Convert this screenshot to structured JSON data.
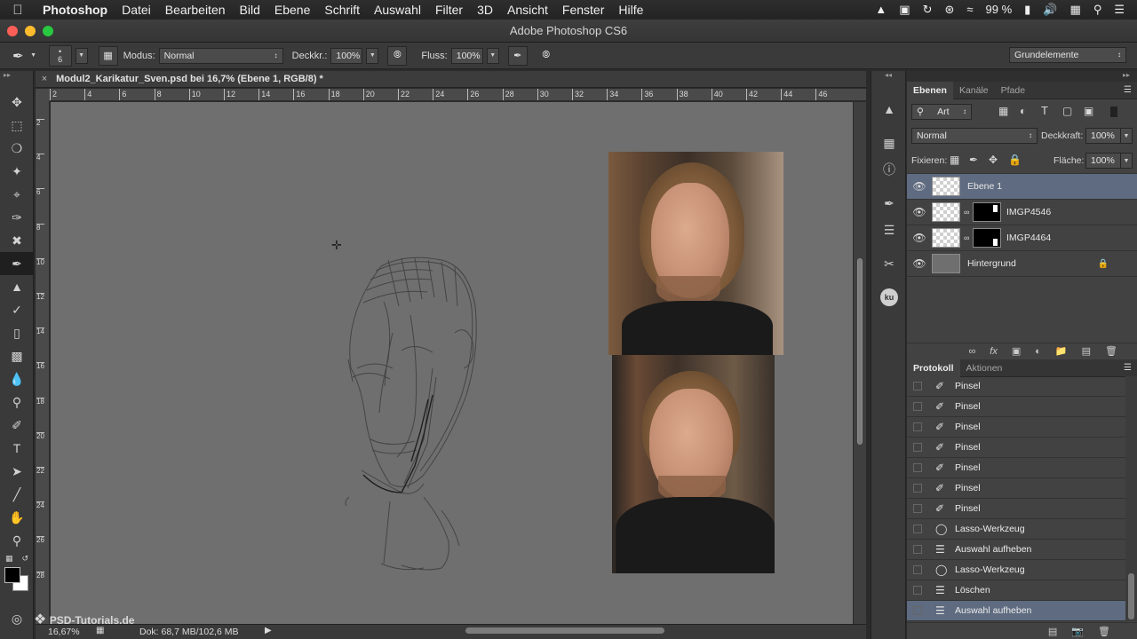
{
  "menubar": {
    "items": [
      "Photoshop",
      "Datei",
      "Bearbeiten",
      "Bild",
      "Ebene",
      "Schrift",
      "Auswahl",
      "Filter",
      "3D",
      "Ansicht",
      "Fenster",
      "Hilfe"
    ],
    "battery": "99 %"
  },
  "window": {
    "title": "Adobe Photoshop CS6"
  },
  "options": {
    "brush_size": "6",
    "modus_label": "Modus:",
    "modus_value": "Normal",
    "opacity_label": "Deckkr.:",
    "opacity_value": "100%",
    "flow_label": "Fluss:",
    "flow_value": "100%",
    "workspace": "Grundelemente"
  },
  "document": {
    "tab_title": "Modul2_Karikatur_Sven.psd bei 16,7% (Ebene 1, RGB/8) *",
    "ruler_top": [
      "2",
      "4",
      "6",
      "8",
      "10",
      "12",
      "14",
      "16",
      "18",
      "20",
      "22",
      "24",
      "26",
      "28",
      "30",
      "32",
      "34",
      "36",
      "38",
      "40",
      "42",
      "44",
      "46"
    ],
    "ruler_left": [
      "2",
      "4",
      "6",
      "8",
      "10",
      "12",
      "14",
      "16",
      "18",
      "20",
      "22",
      "24",
      "26",
      "28"
    ],
    "zoom": "16,67%",
    "doc_info": "Dok: 68,7 MB/102,6 MB",
    "watermark": "PSD-Tutorials.de"
  },
  "layers_panel": {
    "tabs": [
      "Ebenen",
      "Kanäle",
      "Pfade"
    ],
    "filter_kind": "Art",
    "blend_mode": "Normal",
    "opacity_label": "Deckkraft:",
    "opacity_value": "100%",
    "lock_label": "Fixieren:",
    "fill_label": "Fläche:",
    "fill_value": "100%",
    "layers": [
      {
        "name": "Ebene 1",
        "selected": true
      },
      {
        "name": "IMGP4546",
        "selected": false
      },
      {
        "name": "IMGP4464",
        "selected": false
      },
      {
        "name": "Hintergrund",
        "selected": false
      }
    ]
  },
  "history_panel": {
    "tabs": [
      "Protokoll",
      "Aktionen"
    ],
    "items": [
      {
        "label": "Pinsel",
        "icon": "brush-icon"
      },
      {
        "label": "Pinsel",
        "icon": "brush-icon"
      },
      {
        "label": "Pinsel",
        "icon": "brush-icon"
      },
      {
        "label": "Pinsel",
        "icon": "brush-icon"
      },
      {
        "label": "Pinsel",
        "icon": "brush-icon"
      },
      {
        "label": "Pinsel",
        "icon": "brush-icon"
      },
      {
        "label": "Pinsel",
        "icon": "brush-icon"
      },
      {
        "label": "Lasso-Werkzeug",
        "icon": "lasso-icon"
      },
      {
        "label": "Auswahl aufheben",
        "icon": "document-icon"
      },
      {
        "label": "Lasso-Werkzeug",
        "icon": "lasso-icon"
      },
      {
        "label": "Löschen",
        "icon": "document-icon"
      },
      {
        "label": "Auswahl aufheben",
        "icon": "document-icon",
        "selected": true
      }
    ]
  },
  "colors": {
    "selection": "#5e6b80",
    "canvas": "#6f6f6f",
    "panel": "#424242"
  }
}
